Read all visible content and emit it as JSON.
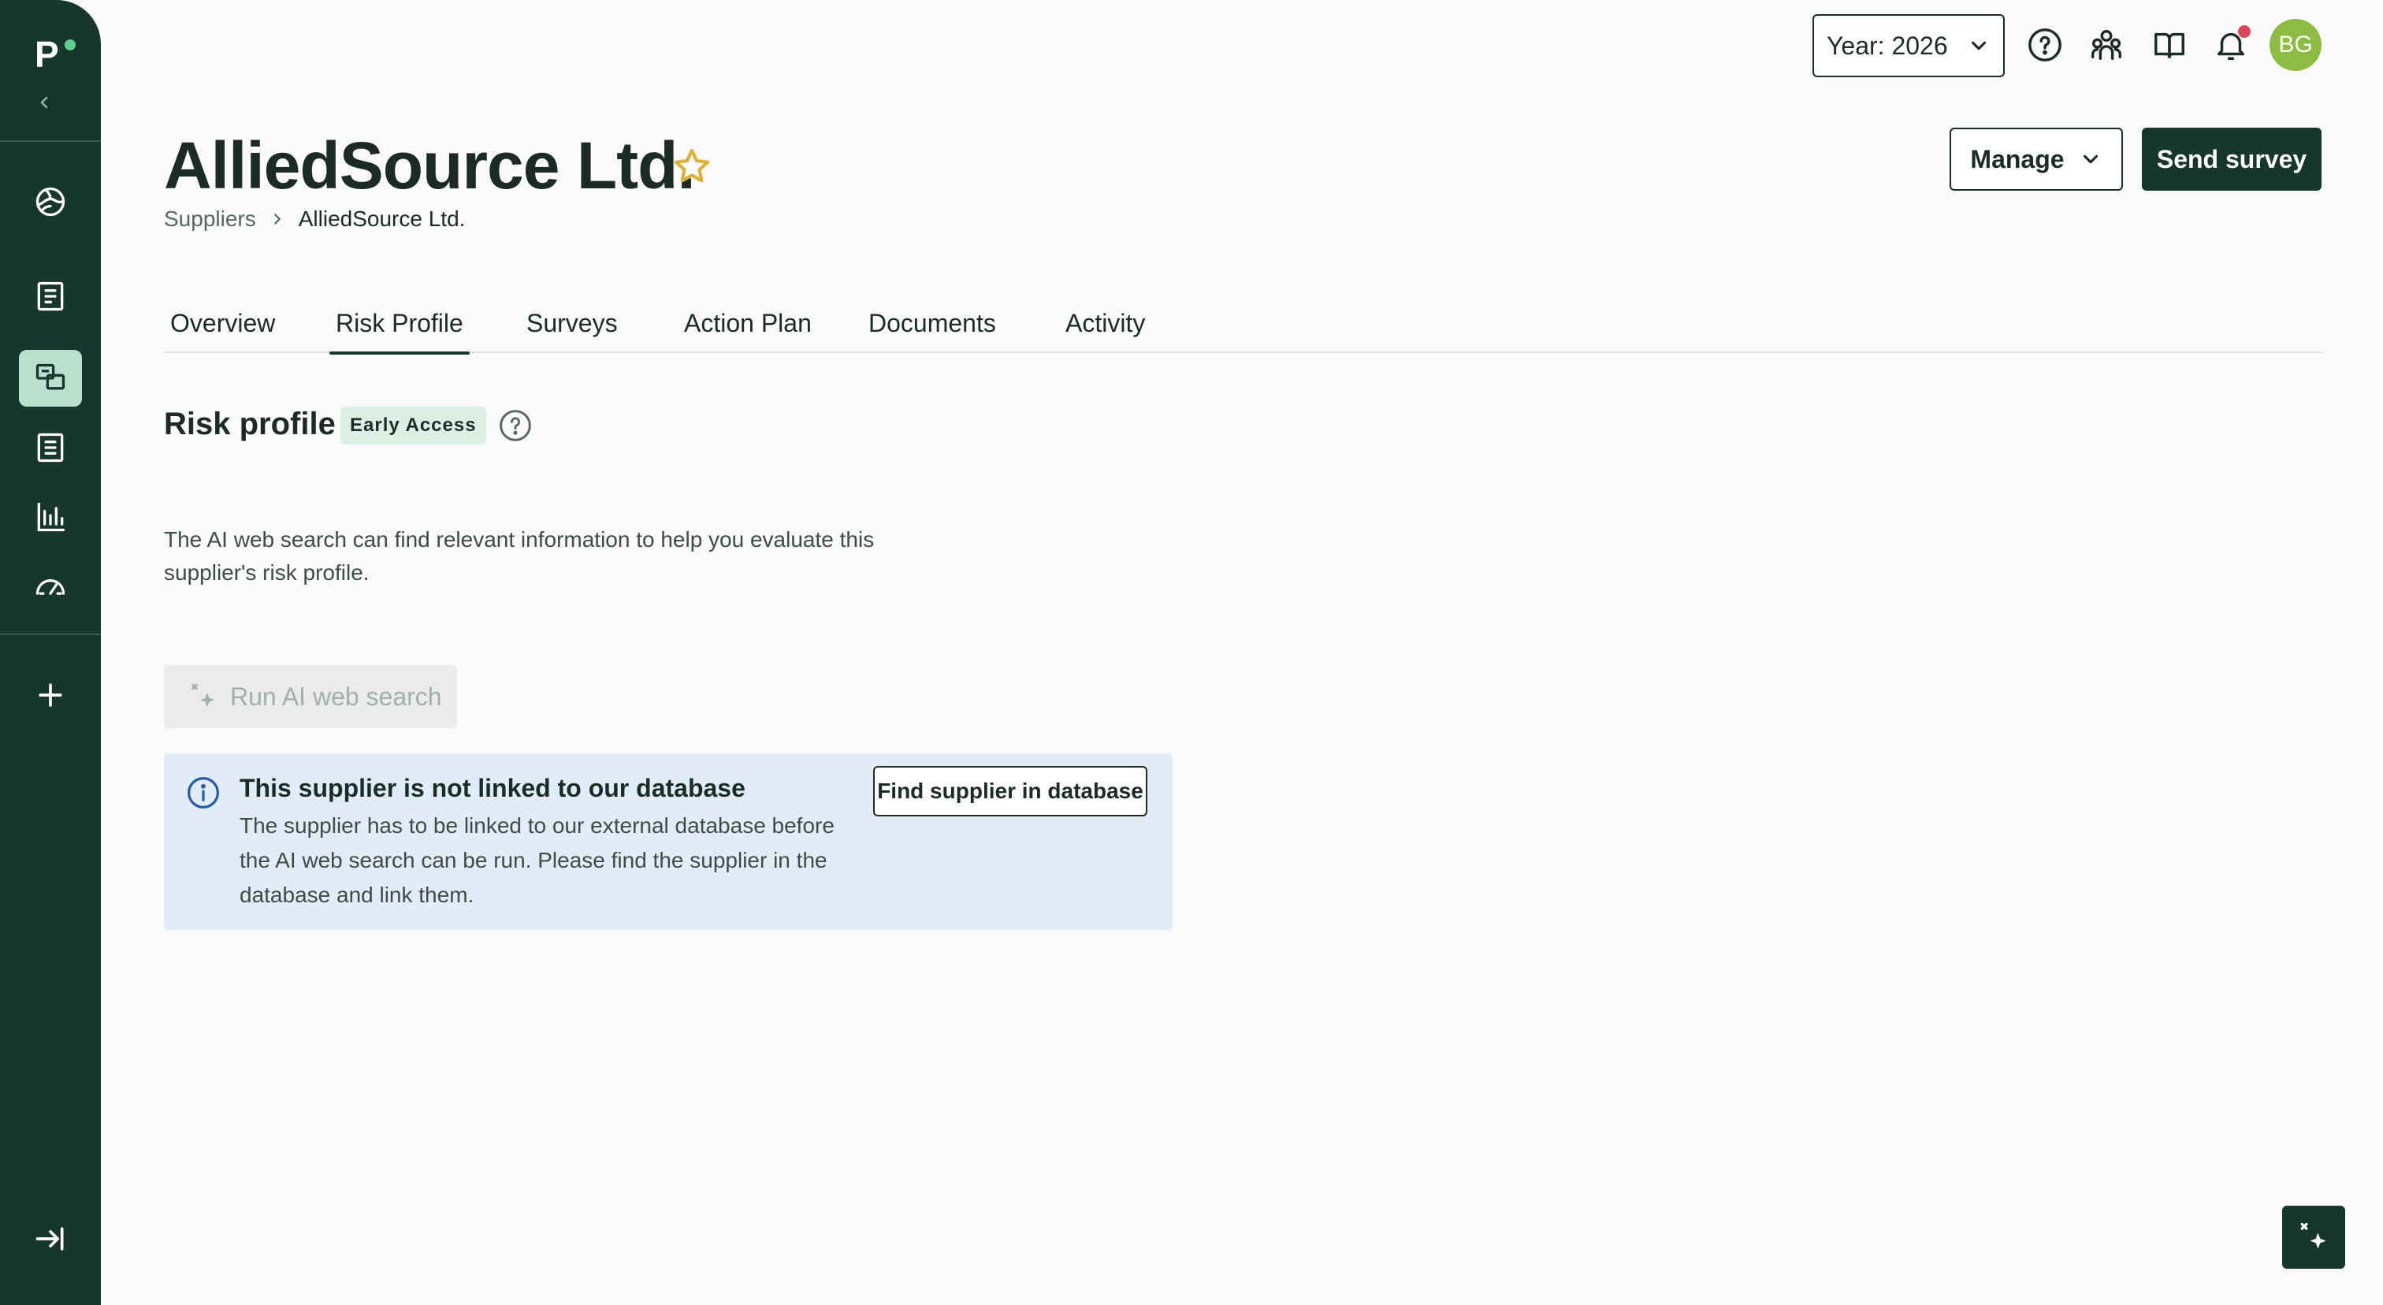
{
  "sidebar": {
    "logo_text": "P",
    "items": [
      {
        "icon": "globe-icon"
      },
      {
        "icon": "document-icon"
      },
      {
        "icon": "suppliers-icon",
        "active": true
      },
      {
        "icon": "list-document-icon"
      },
      {
        "icon": "bar-chart-icon"
      },
      {
        "icon": "gauge-icon"
      },
      {
        "icon": "plus-icon"
      }
    ],
    "expand_icon": "expand-sidebar-icon"
  },
  "topbar": {
    "year_label": "Year: 2026",
    "avatar_initials": "BG"
  },
  "header": {
    "title": "AlliedSource Ltd.",
    "breadcrumb": [
      "Suppliers",
      "AlliedSource Ltd."
    ],
    "manage_label": "Manage",
    "send_survey_label": "Send survey"
  },
  "tabs": [
    {
      "label": "Overview"
    },
    {
      "label": "Risk Profile",
      "active": true
    },
    {
      "label": "Surveys"
    },
    {
      "label": "Action Plan"
    },
    {
      "label": "Documents"
    },
    {
      "label": "Activity"
    }
  ],
  "risk_profile": {
    "title": "Risk profile",
    "badge": "Early Access",
    "description": "The AI web search can find relevant information to help you evaluate this supplier's risk profile.",
    "run_button_label": "Run AI web search",
    "info": {
      "title": "This supplier is not linked to our database",
      "text": "The supplier has to be linked to our external database before the AI web search can be run. Please find the supplier in the database and link them.",
      "button_label": "Find supplier in database"
    }
  },
  "colors": {
    "sidebar_bg": "#17362e",
    "active_nav": "#b9e0cd",
    "primary_button": "#17362e",
    "star": "#d9b13b",
    "avatar": "#8cbc42",
    "info_bg": "#e2ecf6",
    "notification_dot": "#d8485a"
  }
}
